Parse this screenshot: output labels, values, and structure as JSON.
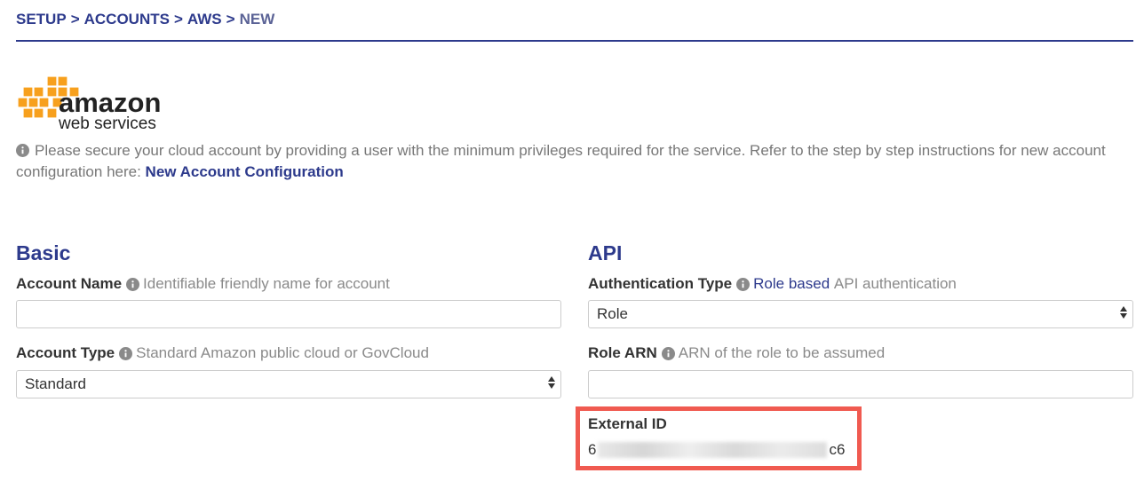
{
  "breadcrumb": {
    "items": [
      "SETUP",
      "ACCOUNTS",
      "AWS"
    ],
    "separator": ">",
    "current": "NEW"
  },
  "logo": {
    "word1": "amazon",
    "word2": "web services",
    "cube_color": "#f7a01d"
  },
  "info": {
    "text": "Please secure your cloud account by providing a user with the minimum privileges required for the service. Refer to the step by step instructions for new account configuration here: ",
    "link_label": "New Account Configuration"
  },
  "basic": {
    "title": "Basic",
    "account_name": {
      "label": "Account Name",
      "hint": "Identifiable friendly name for account",
      "value": ""
    },
    "account_type": {
      "label": "Account Type",
      "hint": "Standard Amazon public cloud or GovCloud",
      "value": "Standard"
    }
  },
  "api": {
    "title": "API",
    "auth_type": {
      "label": "Authentication Type",
      "hint_link": "Role based",
      "hint": "API authentication",
      "value": "Role"
    },
    "role_arn": {
      "label": "Role ARN",
      "hint": "ARN of the role to be assumed",
      "value": ""
    },
    "external_id": {
      "label": "External ID",
      "value_start": "6",
      "value_end": "c6"
    }
  },
  "colors": {
    "accent": "#2d3a8c",
    "highlight_border": "#f05a50"
  }
}
